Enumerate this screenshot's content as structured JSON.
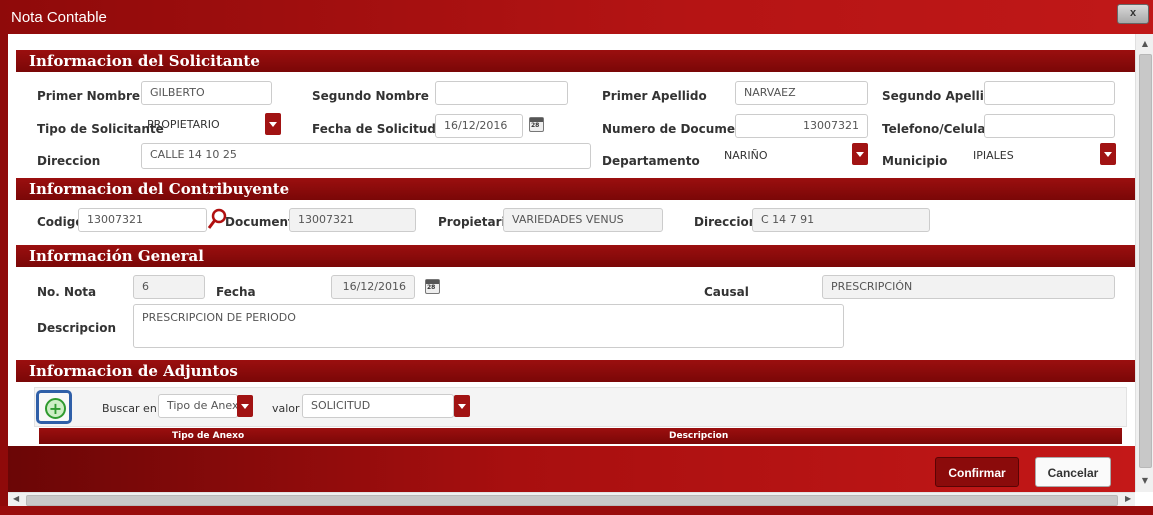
{
  "window": {
    "title": "Nota Contable",
    "close_label": "x"
  },
  "solicitante": {
    "header": "Informacion del Solicitante",
    "primer_nombre_label": "Primer Nombre",
    "primer_nombre": "GILBERTO",
    "segundo_nombre_label": "Segundo Nombre",
    "segundo_nombre": "",
    "primer_apellido_label": "Primer Apellido",
    "primer_apellido": "NARVAEZ",
    "segundo_apellido_label": "Segundo Apellido",
    "segundo_apellido": "",
    "tipo_label": "Tipo de Solicitante",
    "tipo": "PROPIETARIO",
    "fecha_label": "Fecha de Solicitud",
    "fecha": "16/12/2016",
    "numdoc_label": "Numero de Documento",
    "numdoc": "13007321",
    "telefono_label": "Telefono/Celular",
    "telefono": "",
    "direccion_label": "Direccion",
    "direccion": "CALLE 14 10 25",
    "departamento_label": "Departamento",
    "departamento": "NARIÑO",
    "municipio_label": "Municipio",
    "municipio": "IPIALES"
  },
  "contribuyente": {
    "header": "Informacion del Contribuyente",
    "codigo_label": "Codigo",
    "codigo": "13007321",
    "documento_label": "Documento",
    "documento": "13007321",
    "propietario_label": "Propietario",
    "propietario": "VARIEDADES VENUS",
    "direccion_label": "Direccion",
    "direccion": "C 14 7 91"
  },
  "general": {
    "header": "Información General",
    "nota_label": "No. Nota",
    "nota": "6",
    "fecha_label": "Fecha",
    "fecha": "16/12/2016",
    "causal_label": "Causal",
    "causal": "PRESCRIPCIÓN",
    "descripcion_label": "Descripcion",
    "descripcion": "PRESCRIPCION DE PERIODO"
  },
  "adjuntos": {
    "header": "Informacion de Adjuntos",
    "buscar_label": "Buscar en",
    "buscar_value": "Tipo de Anexo",
    "valor_label": "valor",
    "valor_value": "SOLICITUD",
    "columns": [
      "Tipo de Anexo",
      "Descripcion"
    ]
  },
  "calendar_day": "28",
  "footer": {
    "confirm_label": "Confirmar",
    "cancel_label": "Cancelar"
  },
  "colors": {
    "primary": "#9b0f0f",
    "accent_blue": "#2f5fa8",
    "add_green": "#2f9a2f"
  }
}
